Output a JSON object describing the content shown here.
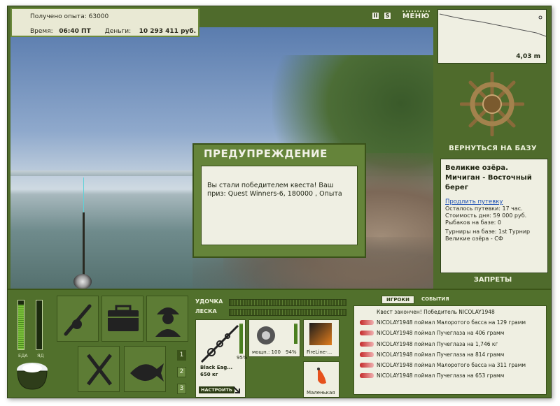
{
  "header": {
    "experience_label": "Получено опыта:",
    "experience_value": "63000",
    "time_label": "Время:",
    "time_value": "06:40 ПТ",
    "money_label": "Деньги:",
    "money_value": "10 293 411 руб."
  },
  "toolbar": {
    "pause_label": "II",
    "settings_label": "S",
    "menu_label": "МЕНЮ"
  },
  "depth_graph": {
    "depth_value": "4,03 m"
  },
  "right_panel": {
    "return_label": "ВЕРНУТЬСЯ НА БАЗУ",
    "location_title": "Великие озёра. Мичиган - Восточный берег",
    "extend_link": "Продлить путевку",
    "lines": [
      "Осталось путевки: 17 час.",
      "Стоимость дня: 59 000 руб.",
      "Рыбаков на базе: 0"
    ],
    "tournaments": "Турниры на базе: 1st Турнир Великие озёра - СФ",
    "bans_label": "ЗАПРЕТЫ"
  },
  "modal": {
    "title": "ПРЕДУПРЕЖДЕНИЕ",
    "message": "Вы стали победителем квеста! Ваш приз: Quest Winners-6, 180000 , Опыта"
  },
  "status": {
    "food_label": "ЕДА",
    "poison_label": "ЯД",
    "food_level": 0.92,
    "poison_level": 0.0
  },
  "action_tiles": [
    {
      "name": "rod-tile",
      "icon": "rod-reel-icon"
    },
    {
      "name": "tackle-box-tile",
      "icon": "tackle-box-icon"
    },
    {
      "name": "fisherman-tile",
      "icon": "fisherman-icon"
    },
    {
      "name": "food-tile",
      "icon": "fork-knife-icon"
    },
    {
      "name": "fish-tile",
      "icon": "fish-icon"
    }
  ],
  "slot_numbers": [
    "1",
    "2",
    "3"
  ],
  "gear": {
    "rod_bar_label": "УДОЧКА",
    "line_bar_label": "ЛЕСКА",
    "rod_name": "Black Eag...",
    "rod_capacity": "650 кг",
    "rod_percent": "95%",
    "tune_label": "НАСТРОИТЬ",
    "reel_power": "мощн.: 100",
    "reel_percent": "94%",
    "line_name": "FireLine-...",
    "lure_name": "Маленькая",
    "rod_level": 0.95,
    "reel_level": 0.94
  },
  "events": {
    "tab_players": "ИГРОКИ",
    "tab_events": "СОБЫТИЯ",
    "header": "Квест закончен! Победитель NICOLAY1948",
    "items": [
      "NICOLAY1948 поймал Малоротого басса на 129 грамм",
      "NICOLAY1948 поймал Пучеглаза на 406 грамм",
      "NICOLAY1948 поймал Пучеглаза на 1,746 кг",
      "NICOLAY1948 поймал Пучеглаза на 814 грамм",
      "NICOLAY1948 поймал Малоротого басса на 311 грамм",
      "NICOLAY1948 поймал Пучеглаза на 653 грамм"
    ]
  }
}
